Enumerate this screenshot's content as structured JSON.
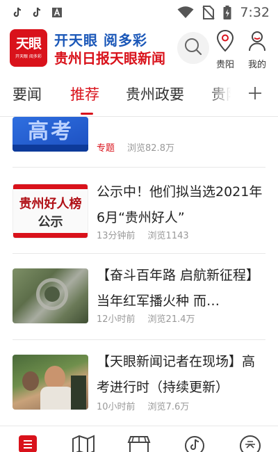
{
  "status_bar": {
    "time": "7:32",
    "left_icons": [
      "tiktok-icon",
      "tiktok-icon",
      "app-a-icon"
    ],
    "right_icons": [
      "wifi-icon",
      "no-sim-icon",
      "battery-charging-icon"
    ]
  },
  "header": {
    "logo": {
      "text": "天眼",
      "sub": "开天眼 阅多彩"
    },
    "slogan": "开天眼 阅多彩",
    "brand": "贵州日报天眼新闻",
    "location_label": "贵阳",
    "profile_label": "我的"
  },
  "tabs": [
    {
      "label": "要闻",
      "active": false
    },
    {
      "label": "推荐",
      "active": true
    },
    {
      "label": "贵州政要",
      "active": false
    },
    {
      "label": "贵阳",
      "active": false
    }
  ],
  "colors": {
    "accent": "#d9121b",
    "blue": "#1a57b8",
    "meta": "#999999"
  },
  "feed": {
    "partial_item": {
      "thumb_text": "高考",
      "tag": "专题",
      "views": "浏览82.8万"
    },
    "items": [
      {
        "title": "公示中！他们拟当选2021年6月“贵州好人”",
        "time": "13分钟前",
        "views": "浏览1143",
        "thumb_line1": "贵州好人榜",
        "thumb_line2": "公示"
      },
      {
        "title": "【奋斗百年路 启航新征程】当年红军播火种 而…",
        "time": "12小时前",
        "views": "浏览21.4万"
      },
      {
        "title": "【天眼新闻记者在现场】高考进行时（持续更新）",
        "time": "10小时前",
        "views": "浏览7.6万"
      }
    ]
  },
  "bottom_nav": [
    "home-icon",
    "map-icon",
    "store-icon",
    "music-icon",
    "tianyan-icon"
  ]
}
